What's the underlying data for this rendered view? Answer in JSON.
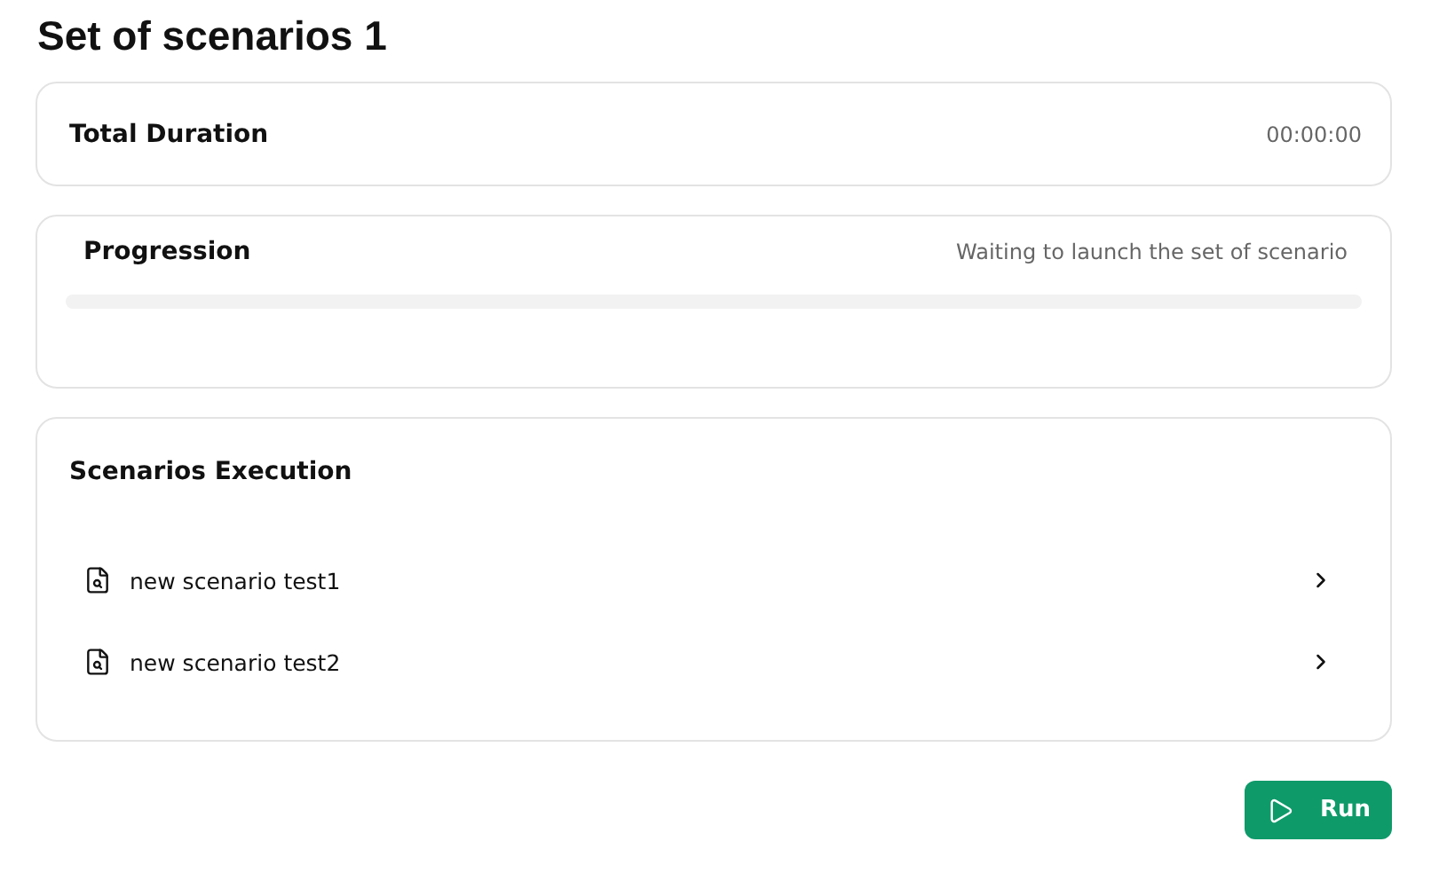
{
  "title": "Set of scenarios 1",
  "duration": {
    "label": "Total Duration",
    "value": "00:00:00"
  },
  "progression": {
    "label": "Progression",
    "status": "Waiting to launch the set of scenario",
    "level": 0
  },
  "execution": {
    "label": "Scenarios Execution",
    "scenarios": [
      {
        "name": "new scenario test1"
      },
      {
        "name": "new scenario test2"
      }
    ]
  },
  "run_button": {
    "label": "Run"
  }
}
